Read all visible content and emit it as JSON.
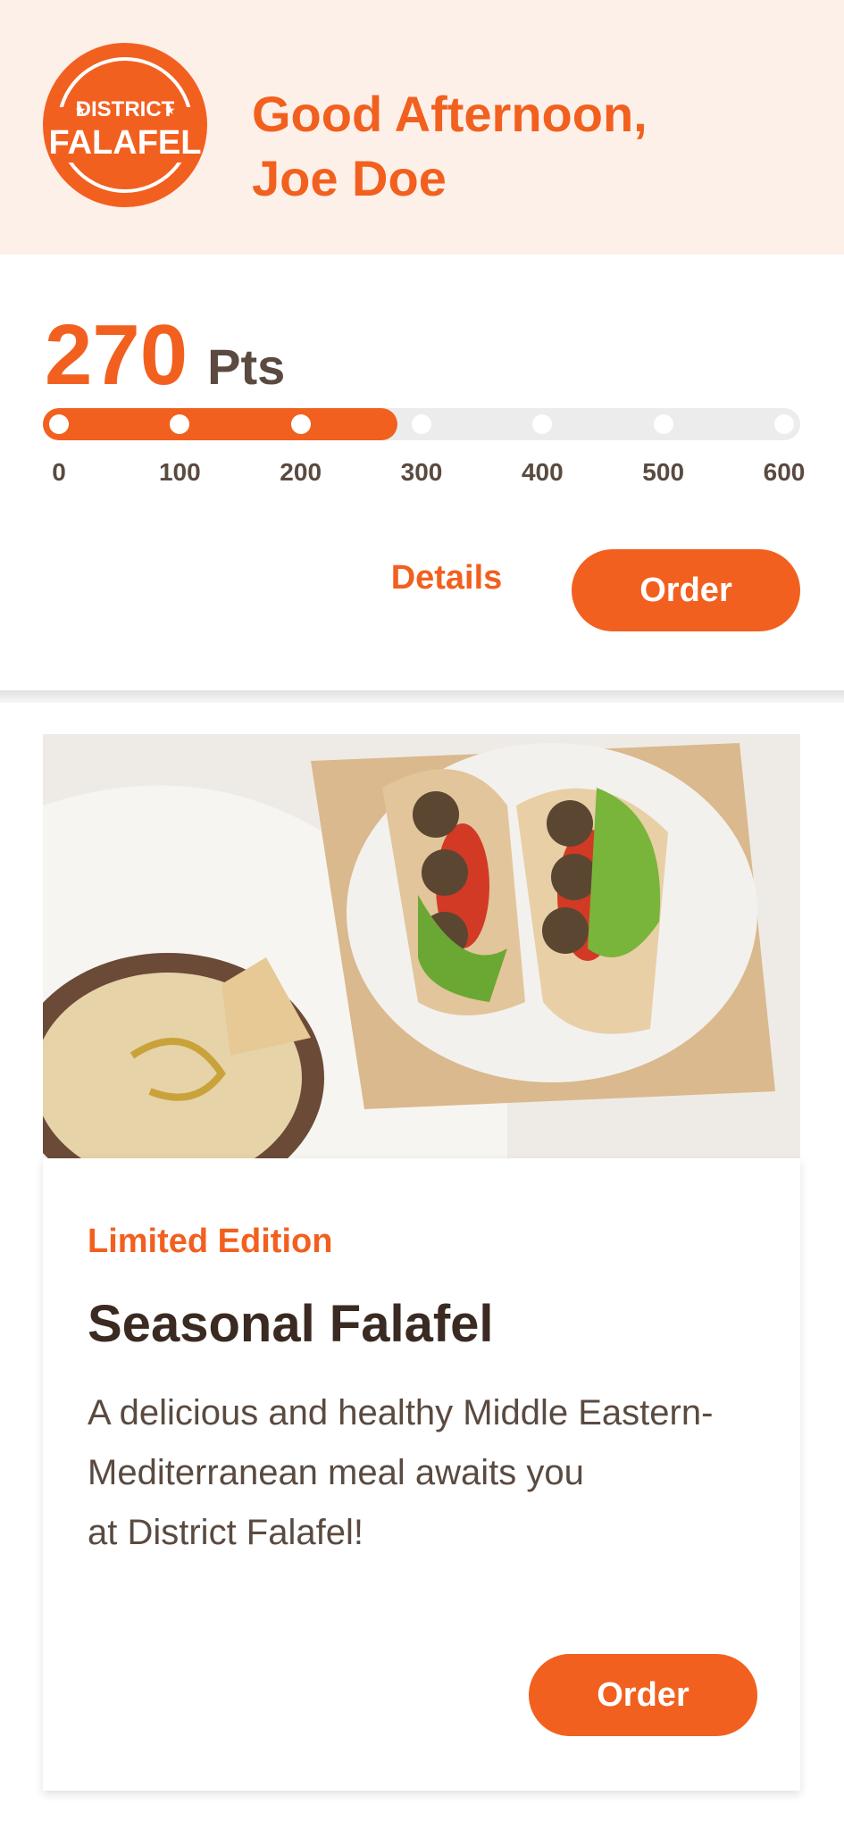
{
  "header": {
    "logo": {
      "line1": "DISTRICT",
      "line2": "FALAFEL"
    },
    "greeting_line1": "Good Afternoon,",
    "greeting_line2": "Joe Doe"
  },
  "points": {
    "value": "270",
    "unit": "Pts",
    "progress_value": 270,
    "progress_max": 600,
    "ticks": [
      "0",
      "100",
      "200",
      "300",
      "400",
      "500",
      "600"
    ],
    "details_label": "Details",
    "order_label": "Order"
  },
  "promo": {
    "image_alt": "falafel-wrap-and-hummus-photo",
    "tag": "Limited Edition",
    "title": "Seasonal Falafel",
    "description_lines": [
      "A delicious and healthy Middle Eastern-",
      "Mediterranean meal awaits you",
      "at District Falafel!"
    ],
    "order_label": "Order"
  },
  "colors": {
    "accent": "#f2601f",
    "header_bg": "#fdf0e8",
    "text_dark": "#3a2a22",
    "text_body": "#5a4a40",
    "track": "#ececec"
  }
}
